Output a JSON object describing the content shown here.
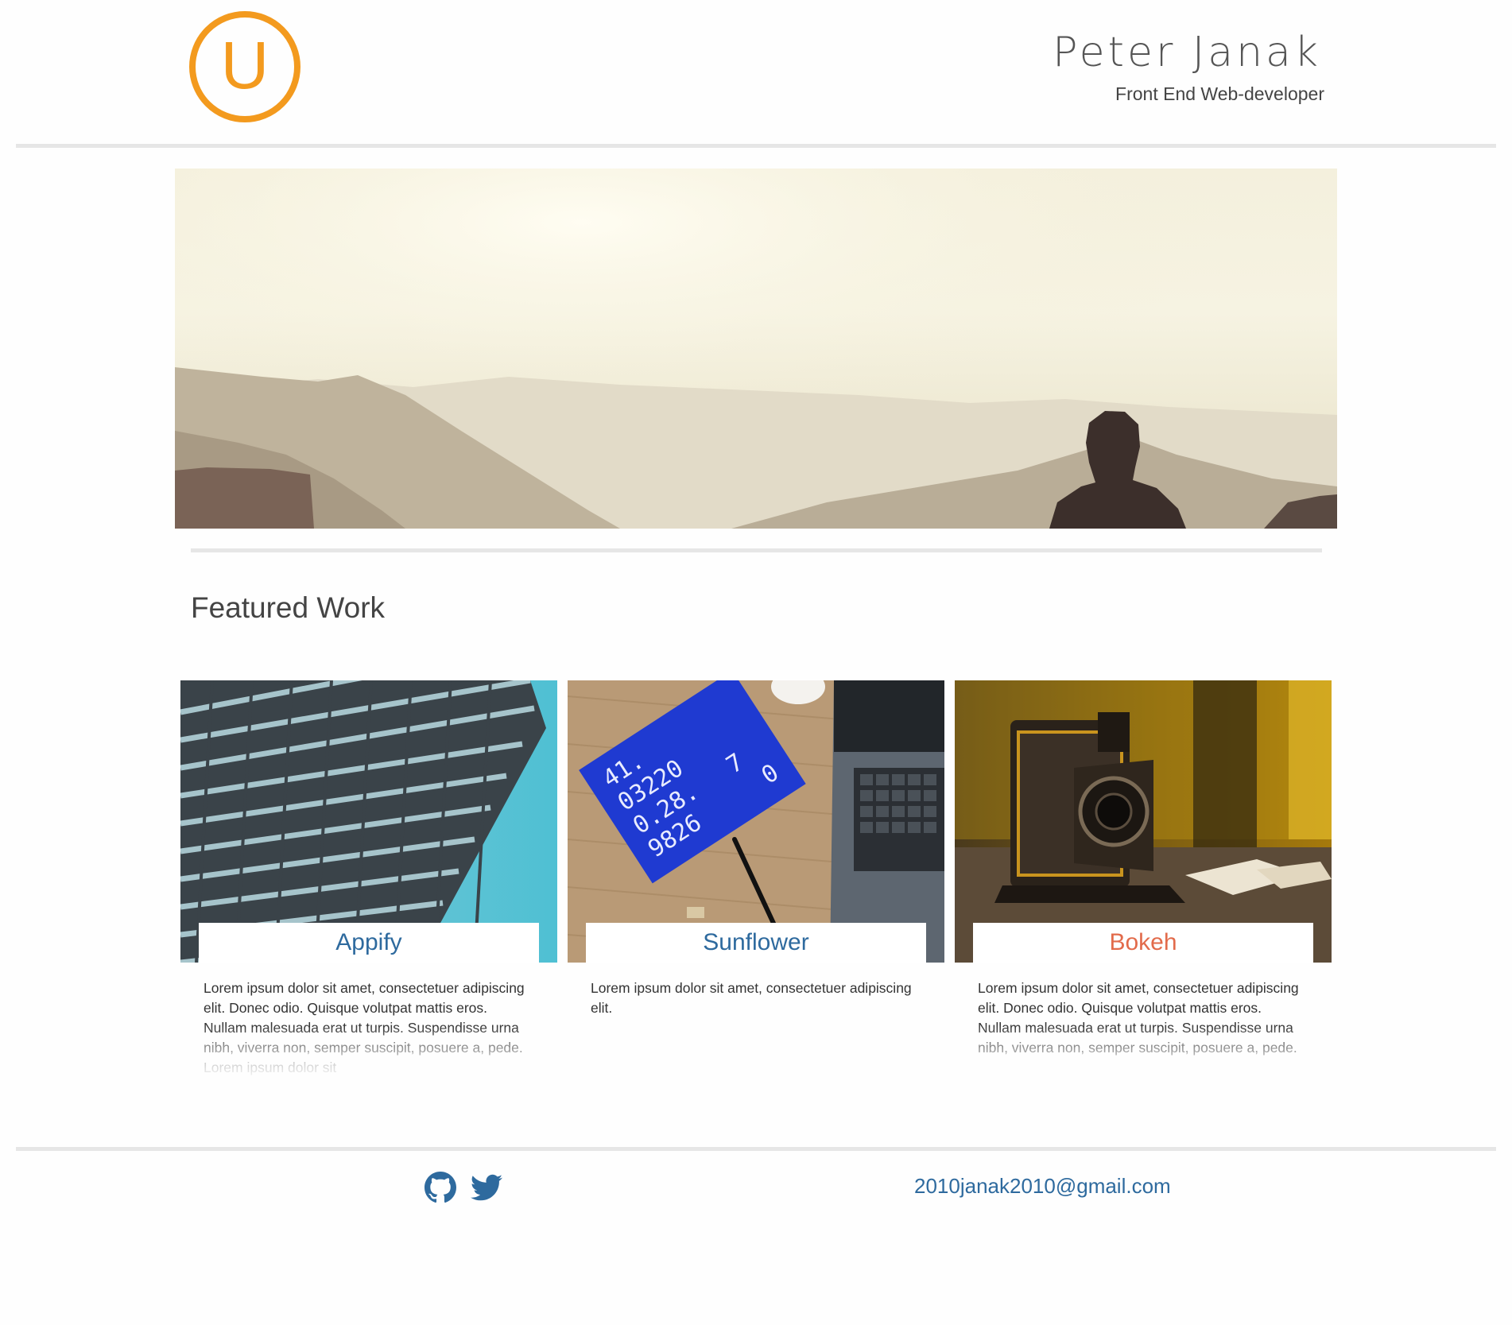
{
  "header": {
    "logo_letter": "U",
    "name": "Peter Janak",
    "role": "Front End Web-developer"
  },
  "featured": {
    "heading": "Featured Work",
    "projects": [
      {
        "title": "Appify",
        "text": "Lorem ipsum dolor sit amet, consectetuer adipiscing elit. Donec odio. Quisque volutpat mattis eros. Nullam malesuada erat ut turpis. Suspendisse urna nibh, viverra non, semper suscipit, posuere a, pede. Lorem ipsum dolor sit"
      },
      {
        "title": "Sunflower",
        "text": "Lorem ipsum dolor sit amet, consectetuer adipiscing elit."
      },
      {
        "title": "Bokeh",
        "text": "Lorem ipsum dolor sit amet, consectetuer adipiscing elit. Donec odio. Quisque volutpat mattis eros. Nullam malesuada erat ut turpis. Suspendisse urna nibh, viverra non, semper suscipit, posuere a, pede."
      }
    ],
    "notebook_digits": [
      "41.",
      "03220",
      "0.28.",
      "9826",
      "0",
      "7"
    ]
  },
  "footer": {
    "social": [
      "github-icon",
      "twitter-icon"
    ],
    "email": "2010janak2010@gmail.com"
  },
  "colors": {
    "accent_orange": "#f39a1e",
    "link_blue": "#2e6a9e",
    "bokeh_red": "#e26b4b",
    "rule_gray": "#e6e6e6"
  }
}
